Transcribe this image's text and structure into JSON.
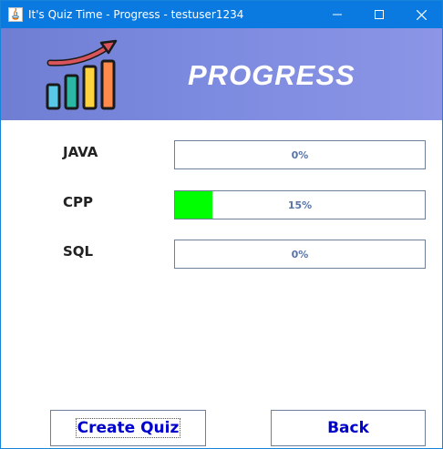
{
  "window": {
    "title": "It's Quiz Time - Progress - testuser1234",
    "accent_color": "#0a79e0"
  },
  "header": {
    "title": "PROGRESS",
    "logo_icon": "bar-chart-growth-icon"
  },
  "subjects": [
    {
      "name": "JAVA",
      "progress_text": "0%",
      "progress_value": 0
    },
    {
      "name": "CPP",
      "progress_text": "15%",
      "progress_value": 15
    },
    {
      "name": "SQL",
      "progress_text": "0%",
      "progress_value": 0
    }
  ],
  "buttons": {
    "create_quiz": "Create Quiz",
    "back": "Back"
  },
  "colors": {
    "progress_fill": "#00ff00",
    "button_text": "#0000cc"
  }
}
